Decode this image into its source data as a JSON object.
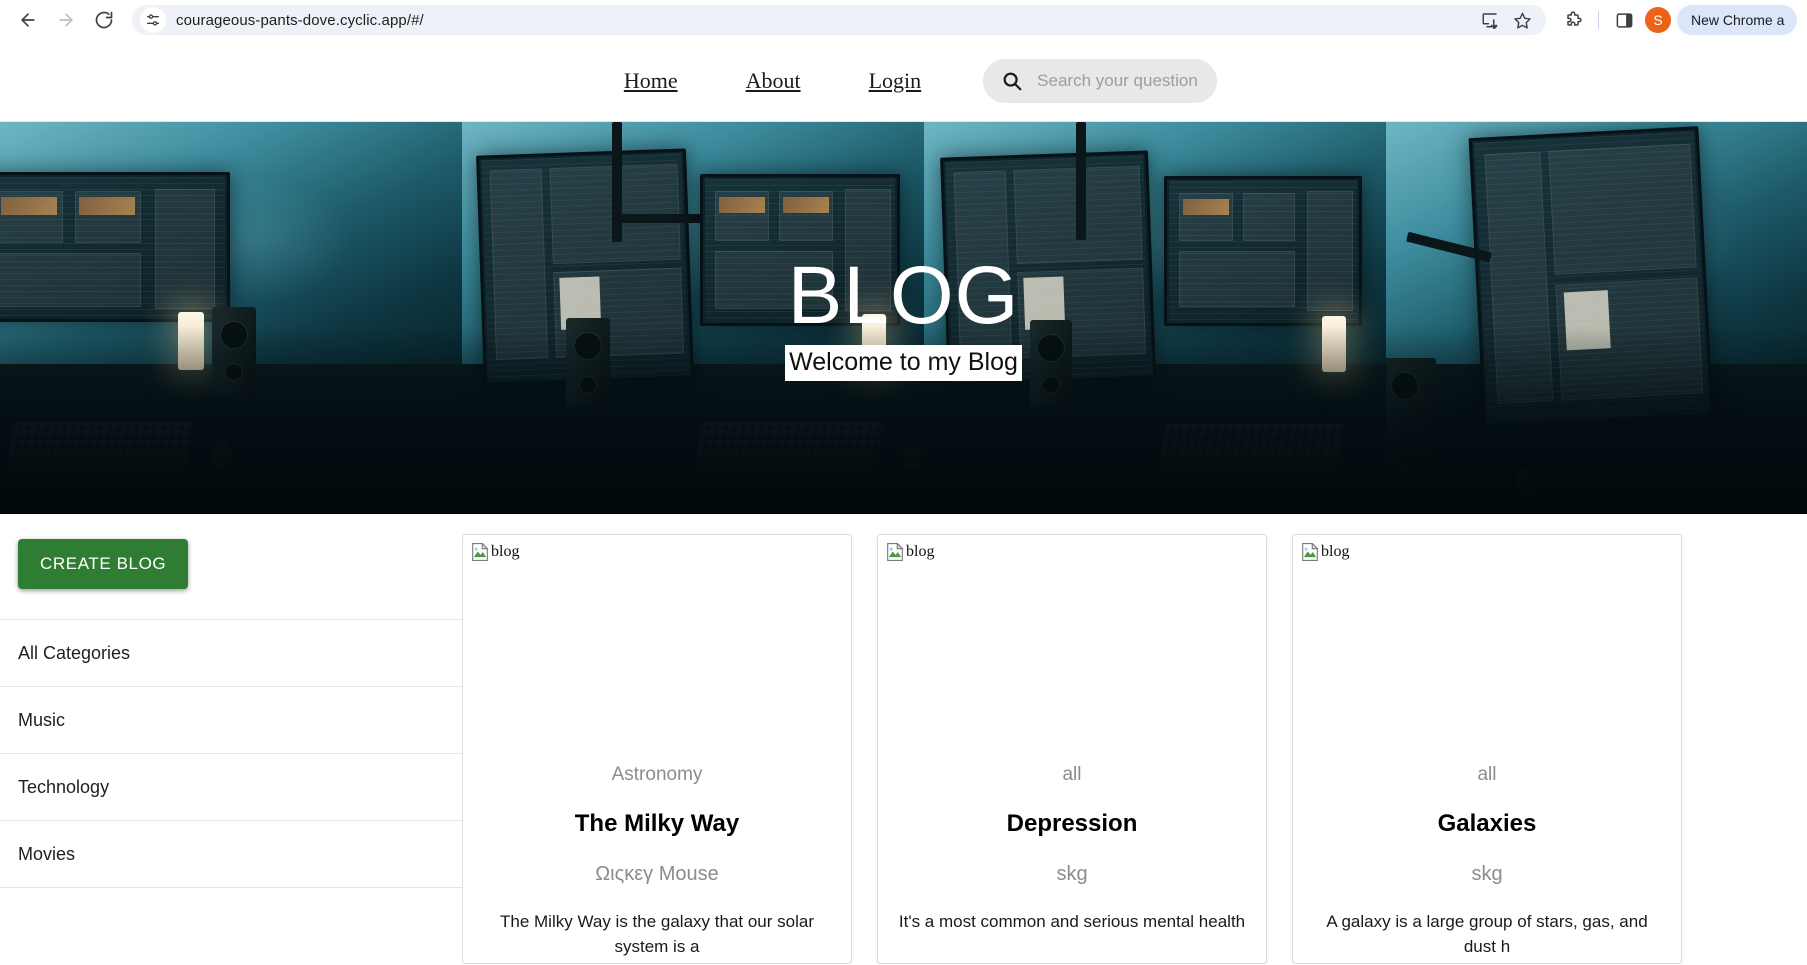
{
  "browser": {
    "url": "courageous-pants-dove.cyclic.app/#/",
    "back_label": "Back",
    "forward_label": "Forward",
    "reload_label": "Reload",
    "site_info_icon": "tune-icon",
    "install_icon": "install-app-icon",
    "bookmark_icon": "star-icon",
    "extensions_icon": "puzzle-piece-icon",
    "side_panel_icon": "side-panel-icon",
    "avatar_letter": "S",
    "avatar_color": "#ec6216",
    "profile_pill": "New Chrome a"
  },
  "site_nav": {
    "links": [
      {
        "label": "Home"
      },
      {
        "label": "About"
      },
      {
        "label": "Login"
      }
    ],
    "search": {
      "icon": "search-icon",
      "placeholder": "Search your question",
      "value": ""
    }
  },
  "hero": {
    "title": "BLOG",
    "subtitle": "Welcome to my Blog"
  },
  "sidebar": {
    "create_button": "CREATE BLOG",
    "create_button_color": "#2e7d32",
    "categories": [
      {
        "label": "All Categories"
      },
      {
        "label": "Music"
      },
      {
        "label": "Technology"
      },
      {
        "label": "Movies"
      }
    ]
  },
  "cards": [
    {
      "image_alt": "blog",
      "category": "Astronomy",
      "title": "The Milky Way",
      "author": "Ωιςκεγ Mouse",
      "excerpt": "The Milky Way is the galaxy that our solar system is a"
    },
    {
      "image_alt": "blog",
      "category": "all",
      "title": "Depression",
      "author": "skg",
      "excerpt": "It's a most common and serious mental health"
    },
    {
      "image_alt": "blog",
      "category": "all",
      "title": "Galaxies",
      "author": "skg",
      "excerpt": "A galaxy is a large group of stars, gas, and dust h"
    }
  ]
}
